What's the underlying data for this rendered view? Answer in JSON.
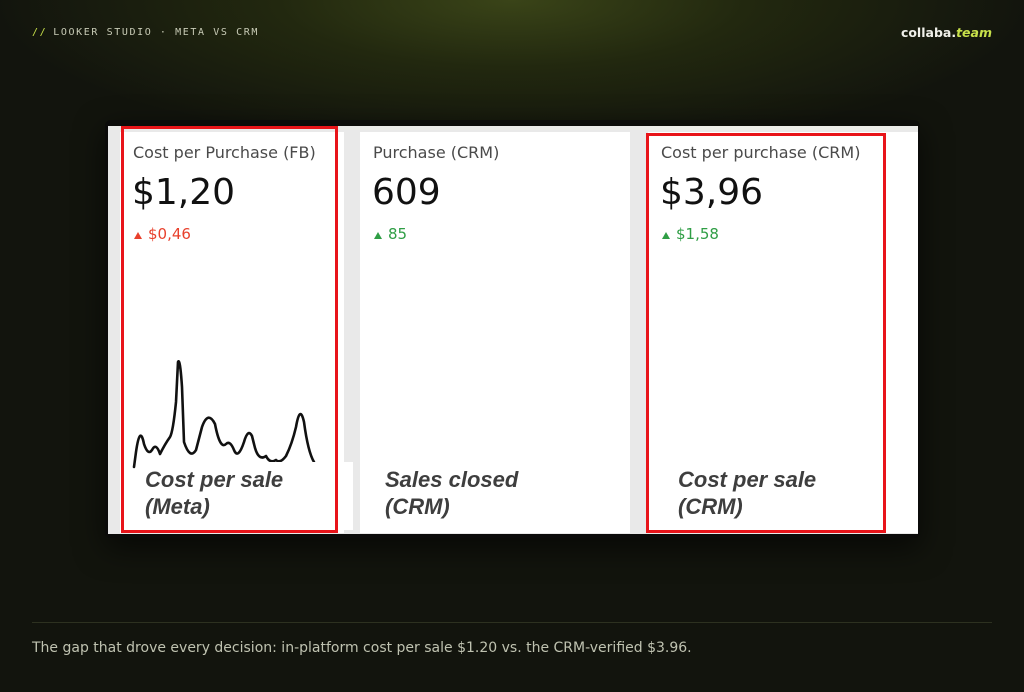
{
  "header": {
    "prefix": "//",
    "crumb": "LOOKER STUDIO · META VS CRM",
    "brand_main": "collaba.",
    "brand_accent": "team"
  },
  "cards": [
    {
      "title": "Cost per Purchase (FB)",
      "value": "$1,20",
      "delta": "$0,46",
      "delta_color": "#e8402c",
      "caption": [
        "Cost per sale",
        "(Meta)"
      ]
    },
    {
      "title": "Purchase (CRM)",
      "value": "609",
      "delta": "85",
      "delta_color": "#2f9e45",
      "caption": [
        "Sales closed",
        "(CRM)"
      ]
    },
    {
      "title": "Cost per purchase (CRM)",
      "value": "$3,96",
      "delta": "$1,58",
      "delta_color": "#2f9e45",
      "caption": [
        "Cost per sale",
        "(CRM)"
      ]
    }
  ],
  "colors": {
    "highlight": "#e8141a",
    "accent": "#c7e04a"
  },
  "footer": {
    "text": "The gap that drove every decision: in-platform cost per sale $1.20 vs. the CRM-verified $3.96."
  }
}
